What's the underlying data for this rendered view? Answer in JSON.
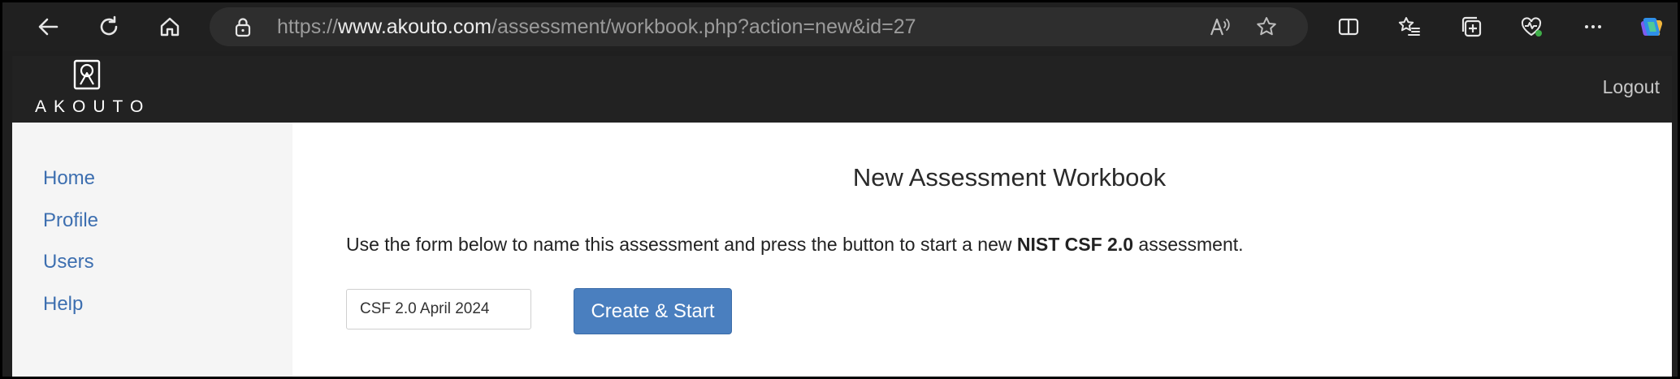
{
  "browser": {
    "url_prefix": "https://",
    "url_host": "www.akouto.com",
    "url_path": "/assessment/workbook.php?action=new&id=27",
    "icons": [
      "back-icon",
      "refresh-icon",
      "home-icon",
      "lock-icon",
      "read-aloud-icon",
      "favorite-star-icon",
      "split-screen-icon",
      "favorites-icon",
      "collections-icon",
      "browser-essentials-icon",
      "more-icon",
      "copilot-icon"
    ]
  },
  "header": {
    "logo_text": "AKOUTO",
    "logout_label": "Logout"
  },
  "sidebar": {
    "items": [
      {
        "label": "Home"
      },
      {
        "label": "Profile"
      },
      {
        "label": "Users"
      },
      {
        "label": "Help"
      }
    ]
  },
  "main": {
    "title": "New Assessment Workbook",
    "intro_before": "Use the form below to name this assessment and press the button to start a new ",
    "intro_bold": "NIST CSF 2.0",
    "intro_after": " assessment.",
    "name_value": "CSF 2.0 April 2024",
    "create_label": "Create & Start"
  },
  "colors": {
    "link": "#3d6fb0",
    "button": "#4a7fbf",
    "header_bg": "#222222"
  }
}
